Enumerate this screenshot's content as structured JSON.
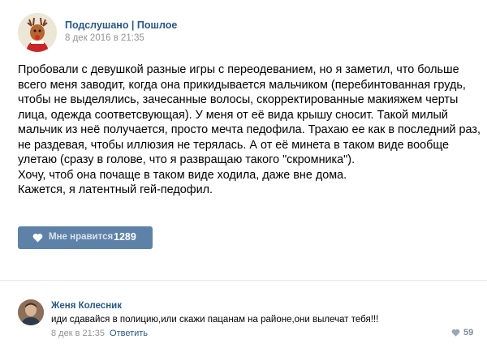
{
  "post": {
    "group_name": "Подслушано | Пошлое",
    "date": "8 дек 2016 в 21:35",
    "text_lines": [
      "Пробовали с девушкой разные игры с переодеванием, но я заметил, что больше",
      "всего меня заводит, когда она прикидывается мальчиком (перебинтованная грудь,",
      "чтобы не выделялись, зачесанные волосы, скорректированные макияжем черты",
      "лица, одежда соответсвующая). У меня от её вида крышу сносит. Такой милый",
      "мальчик из неё получается, просто мечта педофила. Трахаю ее как в последний раз,",
      "не раздевая, чтобы иллюзия не терялась. А от её минета в таком виде вообще",
      "улетаю (сразу в голове, что я развращаю такого \"скромника\").",
      "Хочу, чтоб она почаще в таком виде ходила, даже вне дома.",
      "Кажется, я латентный гей-педофил."
    ],
    "like_label": "Мне нравится",
    "like_count": "1289"
  },
  "comment": {
    "author": "Женя Колесник",
    "text": "иди сдавайся в полицию,или скажи пацанам на районе,они вылечат тебя!!!",
    "date": "8 дек в 21:35",
    "reply_label": "Ответить",
    "like_count": "59"
  },
  "icons": {
    "group_avatar": "reindeer-avatar",
    "author_avatar": "user-photo",
    "like": "heart-icon"
  },
  "colors": {
    "link": "#2a5885",
    "like_button": "#5e81a8",
    "meta": "#939393"
  }
}
